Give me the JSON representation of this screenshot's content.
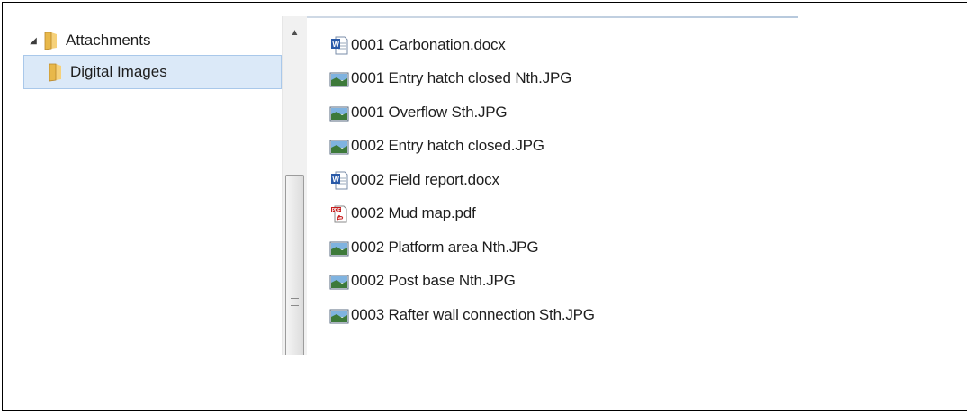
{
  "tree": {
    "items": [
      {
        "label": "Attachments",
        "expanded": true,
        "icon": "folder-icon"
      },
      {
        "label": "Digital Images",
        "selected": true,
        "icon": "folder-icon"
      }
    ]
  },
  "files": [
    {
      "name": "0001 Carbonation.docx",
      "icon": "word-doc-icon"
    },
    {
      "name": "0001 Entry hatch closed Nth.JPG",
      "icon": "image-file-icon"
    },
    {
      "name": "0001 Overflow Sth.JPG",
      "icon": "image-file-icon"
    },
    {
      "name": "0002 Entry hatch closed.JPG",
      "icon": "image-file-icon"
    },
    {
      "name": "0002 Field report.docx",
      "icon": "word-doc-icon"
    },
    {
      "name": "0002 Mud map.pdf",
      "icon": "pdf-file-icon"
    },
    {
      "name": "0002 Platform area Nth.JPG",
      "icon": "image-file-icon"
    },
    {
      "name": "0002 Post base Nth.JPG",
      "icon": "image-file-icon"
    },
    {
      "name": "0003 Rafter wall connection Sth.JPG",
      "icon": "image-file-icon"
    }
  ],
  "colors": {
    "selection_bg": "#dbe9f8",
    "selection_border": "#a9c8ea",
    "folder": "#e8b84a"
  }
}
